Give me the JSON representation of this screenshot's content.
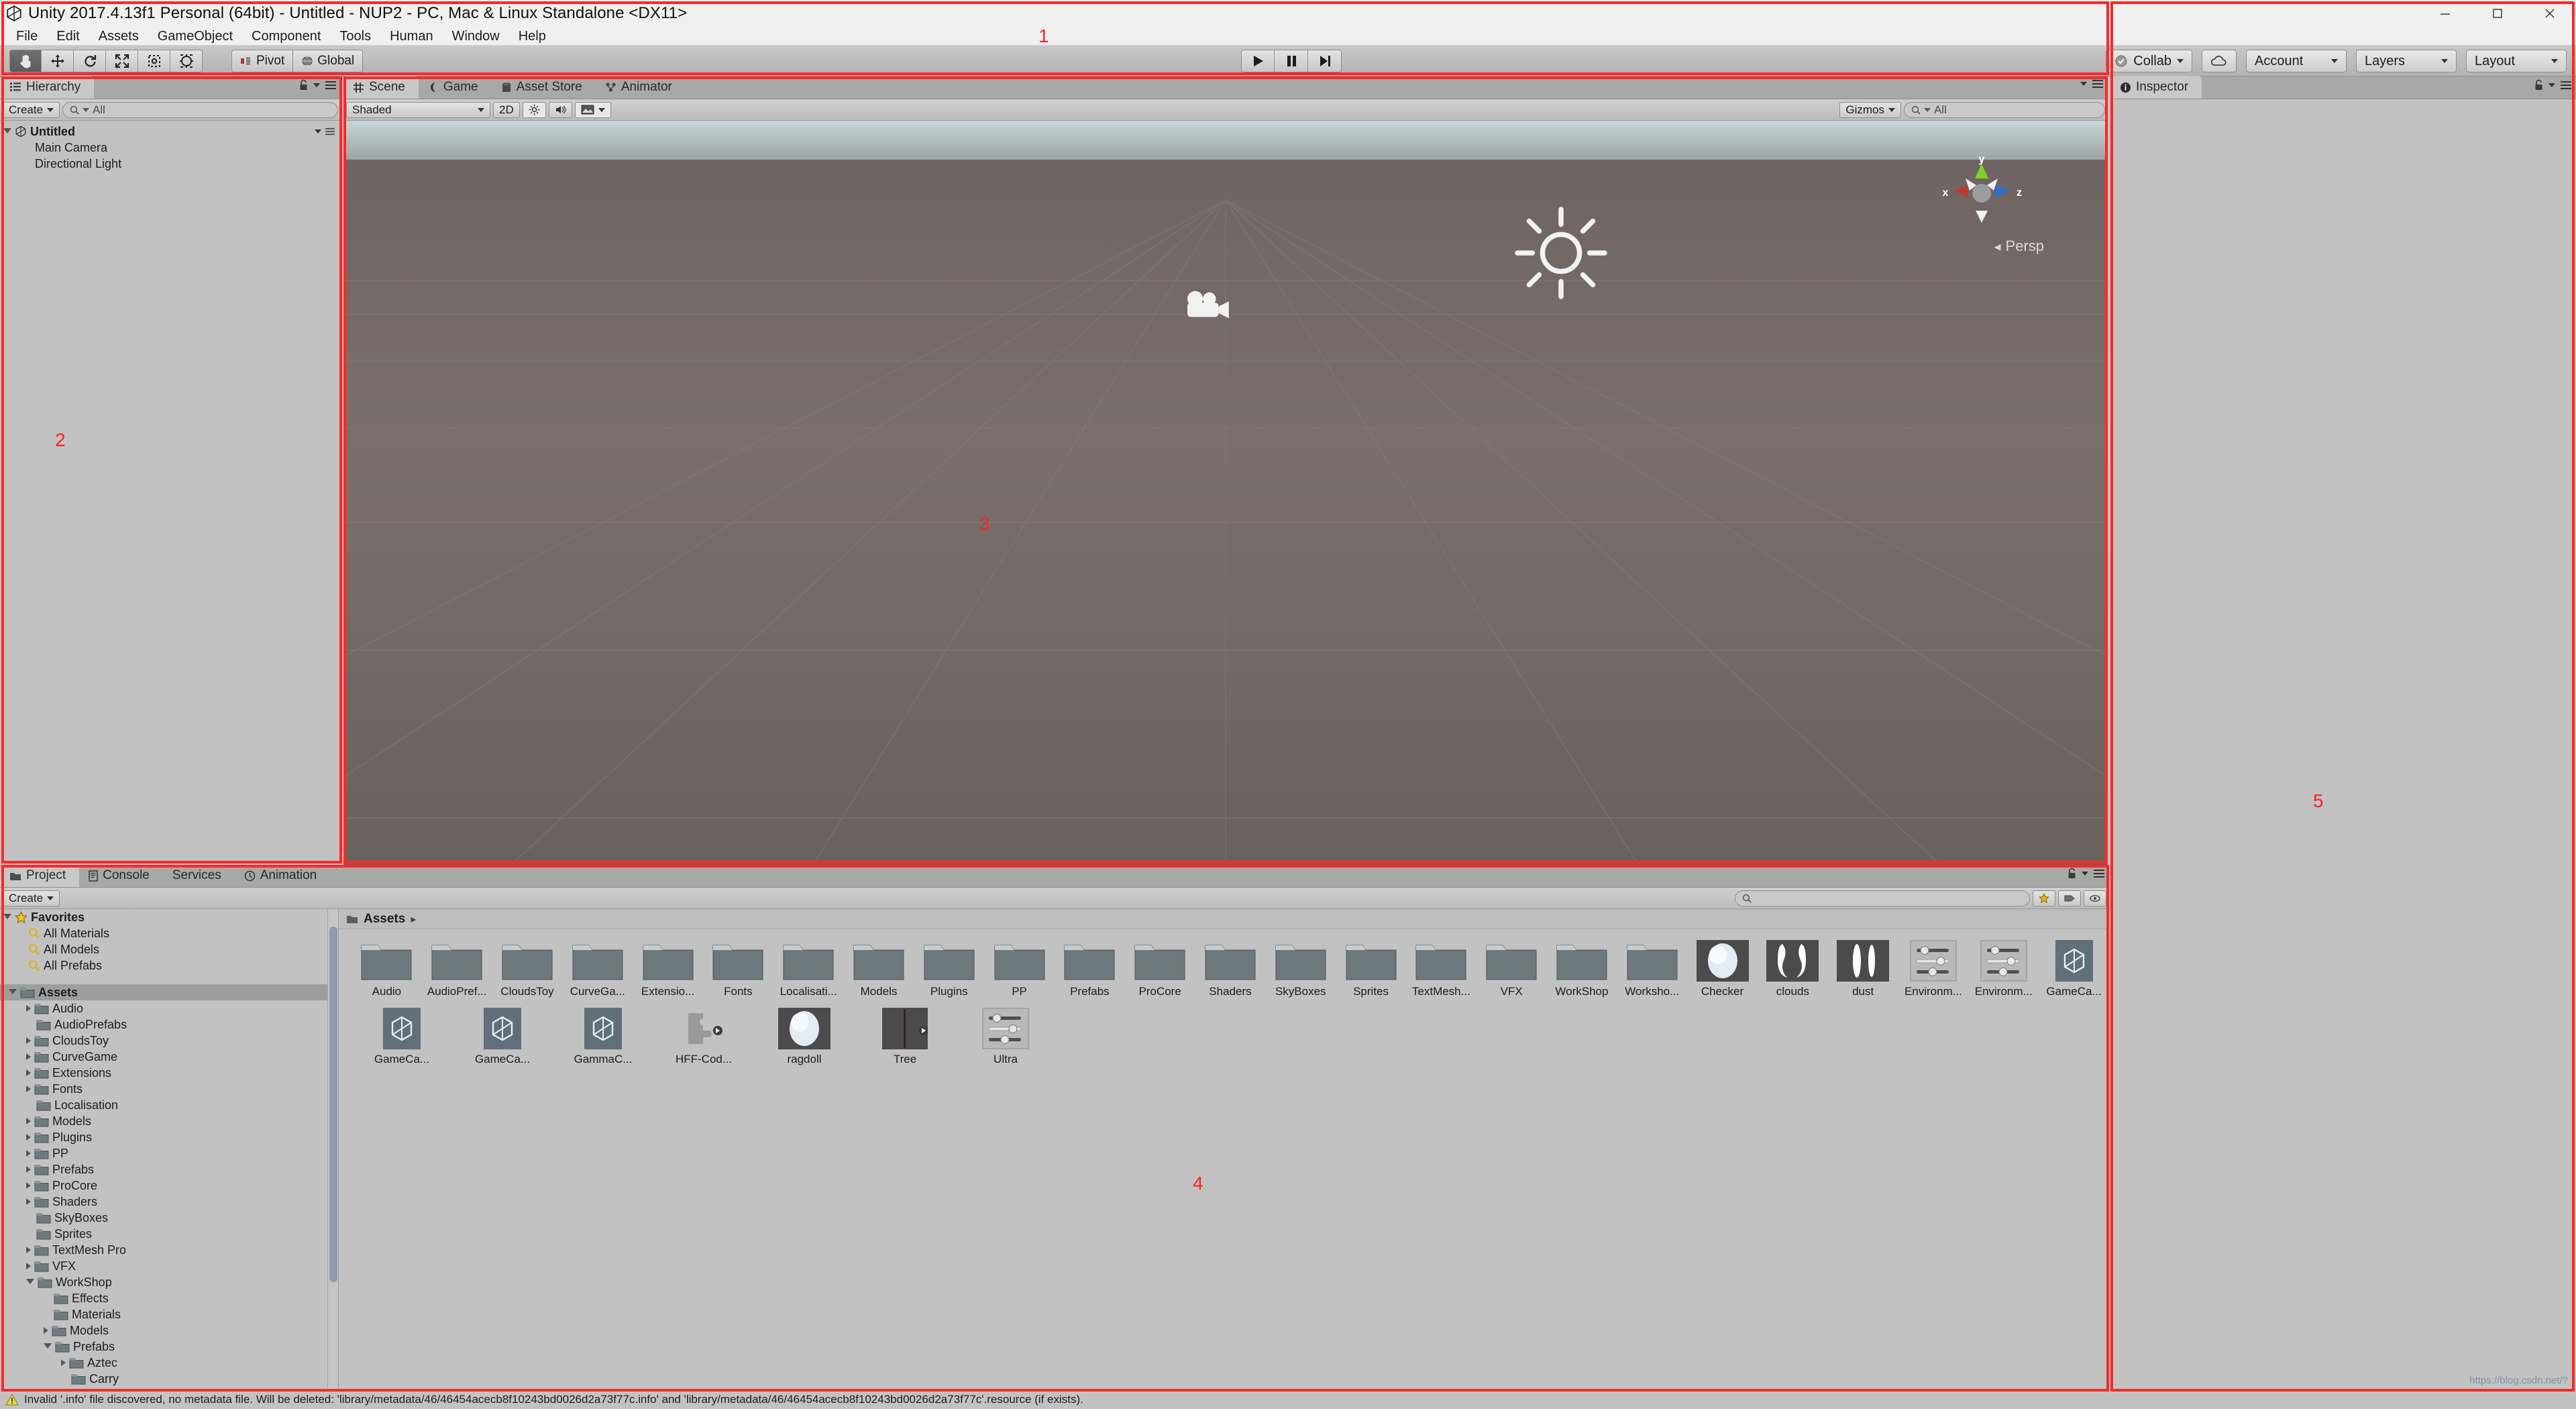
{
  "window": {
    "title": "Unity 2017.4.13f1 Personal (64bit) - Untitled - NUP2 - PC, Mac & Linux Standalone <DX11>",
    "icon": "unity-icon",
    "minimize": "minimize-button",
    "maximize": "maximize-button",
    "close": "close-button"
  },
  "menubar": {
    "items": [
      {
        "label": "File"
      },
      {
        "label": "Edit"
      },
      {
        "label": "Assets"
      },
      {
        "label": "GameObject"
      },
      {
        "label": "Component"
      },
      {
        "label": "Tools"
      },
      {
        "label": "Human"
      },
      {
        "label": "Window"
      },
      {
        "label": "Help"
      }
    ]
  },
  "toolbar": {
    "transform_tools": [
      {
        "name": "hand-tool",
        "active": true
      },
      {
        "name": "move-tool",
        "active": false
      },
      {
        "name": "rotate-tool",
        "active": false
      },
      {
        "name": "scale-tool",
        "active": false
      },
      {
        "name": "rect-tool",
        "active": false
      },
      {
        "name": "transform-tool",
        "active": false
      }
    ],
    "pivot_label": "Pivot",
    "global_label": "Global",
    "play_label": "play-button",
    "pause_label": "pause-button",
    "step_label": "step-button",
    "collab_label": "Collab",
    "cloud_label": "cloud-button",
    "account_label": "Account",
    "layers_label": "Layers",
    "layout_label": "Layout"
  },
  "hierarchy": {
    "tab": "Hierarchy",
    "create_label": "Create",
    "search_placeholder": "All",
    "scene_name": "Untitled",
    "objects": [
      {
        "label": "Main Camera"
      },
      {
        "label": "Directional Light"
      }
    ]
  },
  "scene": {
    "tabs": [
      {
        "label": "Scene",
        "icon": "grid-icon",
        "active": true
      },
      {
        "label": "Game",
        "icon": "gamepad-icon",
        "active": false
      },
      {
        "label": "Asset Store",
        "icon": "store-icon",
        "active": false
      },
      {
        "label": "Animator",
        "icon": "animator-icon",
        "active": false
      }
    ],
    "shading_mode": "Shaded",
    "mode_2d": "2D",
    "lighting_toggle": "lighting-icon",
    "audio_toggle": "audio-icon",
    "fx_toggle": "fx-icon",
    "gizmos_label": "Gizmos",
    "search_placeholder": "All",
    "axis_x": "x",
    "axis_y": "y",
    "axis_z": "z",
    "projection": "Persp"
  },
  "inspector": {
    "tab": "Inspector",
    "lock_icon": "lock-icon",
    "menu_icon": "hamburger-icon"
  },
  "project": {
    "tabs": [
      {
        "label": "Project",
        "icon": "folder-icon",
        "active": true
      },
      {
        "label": "Console",
        "icon": "console-icon",
        "active": false
      },
      {
        "label": "Services",
        "icon": "",
        "active": false
      },
      {
        "label": "Animation",
        "icon": "clock-icon",
        "active": false
      }
    ],
    "create_label": "Create",
    "search_placeholder": "",
    "breadcrumb": "Assets",
    "favorites": {
      "label": "Favorites",
      "items": [
        {
          "label": "All Materials"
        },
        {
          "label": "All Models"
        },
        {
          "label": "All Prefabs"
        }
      ]
    },
    "tree": [
      {
        "label": "Assets",
        "depth": 0,
        "arrow": "open",
        "selected": true
      },
      {
        "label": "Audio",
        "depth": 1,
        "arrow": "closed",
        "selected": false
      },
      {
        "label": "AudioPrefabs",
        "depth": 1,
        "arrow": "none",
        "selected": false
      },
      {
        "label": "CloudsToy",
        "depth": 1,
        "arrow": "closed",
        "selected": false
      },
      {
        "label": "CurveGame",
        "depth": 1,
        "arrow": "closed",
        "selected": false
      },
      {
        "label": "Extensions",
        "depth": 1,
        "arrow": "closed",
        "selected": false
      },
      {
        "label": "Fonts",
        "depth": 1,
        "arrow": "closed",
        "selected": false
      },
      {
        "label": "Localisation",
        "depth": 1,
        "arrow": "none",
        "selected": false
      },
      {
        "label": "Models",
        "depth": 1,
        "arrow": "closed",
        "selected": false
      },
      {
        "label": "Plugins",
        "depth": 1,
        "arrow": "closed",
        "selected": false
      },
      {
        "label": "PP",
        "depth": 1,
        "arrow": "closed",
        "selected": false
      },
      {
        "label": "Prefabs",
        "depth": 1,
        "arrow": "closed",
        "selected": false
      },
      {
        "label": "ProCore",
        "depth": 1,
        "arrow": "closed",
        "selected": false
      },
      {
        "label": "Shaders",
        "depth": 1,
        "arrow": "closed",
        "selected": false
      },
      {
        "label": "SkyBoxes",
        "depth": 1,
        "arrow": "none",
        "selected": false
      },
      {
        "label": "Sprites",
        "depth": 1,
        "arrow": "none",
        "selected": false
      },
      {
        "label": "TextMesh Pro",
        "depth": 1,
        "arrow": "closed",
        "selected": false
      },
      {
        "label": "VFX",
        "depth": 1,
        "arrow": "closed",
        "selected": false
      },
      {
        "label": "WorkShop",
        "depth": 1,
        "arrow": "open",
        "selected": false
      },
      {
        "label": "Effects",
        "depth": 2,
        "arrow": "none",
        "selected": false
      },
      {
        "label": "Materials",
        "depth": 2,
        "arrow": "none",
        "selected": false
      },
      {
        "label": "Models",
        "depth": 2,
        "arrow": "closed",
        "selected": false
      },
      {
        "label": "Prefabs",
        "depth": 2,
        "arrow": "open",
        "selected": false
      },
      {
        "label": "Aztec",
        "depth": 3,
        "arrow": "closed",
        "selected": false
      },
      {
        "label": "Carry",
        "depth": 3,
        "arrow": "none",
        "selected": false
      }
    ],
    "assets_row1": [
      {
        "label": "Audio",
        "kind": "folder"
      },
      {
        "label": "AudioPref...",
        "kind": "folder"
      },
      {
        "label": "CloudsToy",
        "kind": "folder"
      },
      {
        "label": "CurveGa...",
        "kind": "folder"
      },
      {
        "label": "Extensio...",
        "kind": "folder"
      },
      {
        "label": "Fonts",
        "kind": "folder"
      },
      {
        "label": "Localisati...",
        "kind": "folder"
      },
      {
        "label": "Models",
        "kind": "folder"
      },
      {
        "label": "Plugins",
        "kind": "folder"
      },
      {
        "label": "PP",
        "kind": "folder"
      },
      {
        "label": "Prefabs",
        "kind": "folder"
      },
      {
        "label": "ProCore",
        "kind": "folder"
      },
      {
        "label": "Shaders",
        "kind": "folder"
      },
      {
        "label": "SkyBoxes",
        "kind": "folder"
      },
      {
        "label": "Sprites",
        "kind": "folder"
      },
      {
        "label": "TextMesh...",
        "kind": "folder"
      },
      {
        "label": "VFX",
        "kind": "folder"
      },
      {
        "label": "WorkShop",
        "kind": "folder"
      },
      {
        "label": "Worksho...",
        "kind": "folder"
      },
      {
        "label": "Checker",
        "kind": "material"
      },
      {
        "label": "clouds",
        "kind": "texture-clouds"
      },
      {
        "label": "dust",
        "kind": "texture-dust"
      },
      {
        "label": "Environm...",
        "kind": "preset"
      },
      {
        "label": "Environm...",
        "kind": "preset"
      },
      {
        "label": "GameCa...",
        "kind": "prefab"
      }
    ],
    "assets_row2": [
      {
        "label": "GameCa...",
        "kind": "prefab"
      },
      {
        "label": "GameCa...",
        "kind": "prefab"
      },
      {
        "label": "GammaC...",
        "kind": "prefab"
      },
      {
        "label": "HFF-Cod...",
        "kind": "script"
      },
      {
        "label": "ragdoll",
        "kind": "material"
      },
      {
        "label": "Tree",
        "kind": "model"
      },
      {
        "label": "Ultra",
        "kind": "preset"
      }
    ]
  },
  "statusbar": {
    "icon": "warning-icon",
    "message": "Invalid '.info' file discovered, no metadata file. Will be deleted: 'library/metadata/46/46454acecb8f10243bd0026d2a73f77c.info' and 'library/metadata/46/46454acecb8f10243bd0026d2a73f77c'.resource (if exists)."
  },
  "annotations": [
    {
      "n": "1"
    },
    {
      "n": "2"
    },
    {
      "n": "3"
    },
    {
      "n": "4"
    },
    {
      "n": "5"
    }
  ],
  "watermark": "https://blog.csdn.net/?",
  "colors": {
    "annotation": "#fb2828",
    "panel": "#c2c2c2",
    "tabstrip": "#a8a8a8"
  }
}
